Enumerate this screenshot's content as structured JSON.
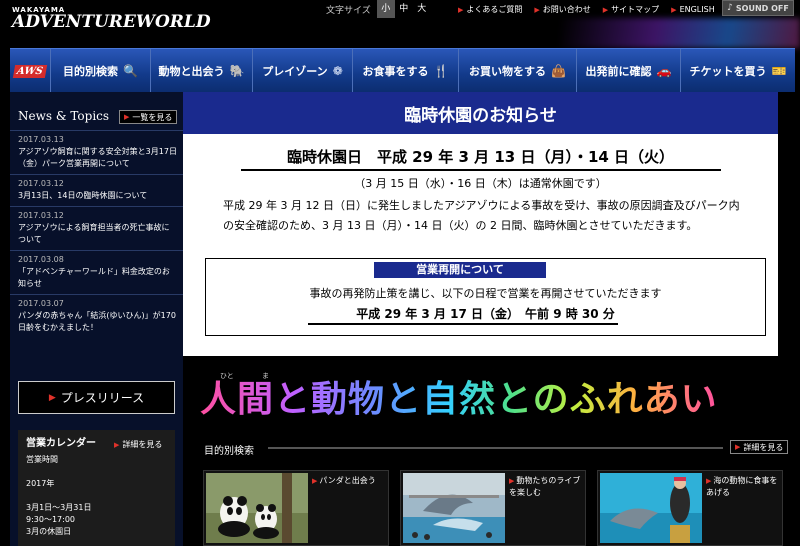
{
  "header": {
    "logo_small": "WAKAYAMA",
    "logo_main": "ADVENTUREWORLD",
    "font_size_label": "文字サイズ",
    "font_sizes": [
      "小",
      "中",
      "大"
    ],
    "font_size_selected": "小",
    "links": [
      "よくあるご質問",
      "お問い合わせ",
      "サイトマップ",
      "ENGLISH"
    ],
    "sound_label": "SOUND OFF"
  },
  "nav": {
    "logo": "AWS",
    "items": [
      {
        "label": "目的別検索",
        "icon": "search-icon",
        "glyph": "🔍"
      },
      {
        "label": "動物と出会う",
        "icon": "elephant-icon",
        "glyph": "🐘"
      },
      {
        "label": "プレイゾーン",
        "icon": "ferris-wheel-icon",
        "glyph": "❁"
      },
      {
        "label": "お食事をする",
        "icon": "cutlery-icon",
        "glyph": "🍴"
      },
      {
        "label": "お買い物をする",
        "icon": "shopping-bag-icon",
        "glyph": "👜"
      },
      {
        "label": "出発前に確認",
        "icon": "car-icon",
        "glyph": "🚗"
      },
      {
        "label": "チケットを買う",
        "icon": "ticket-icon",
        "glyph": "🎫"
      }
    ]
  },
  "sidebar": {
    "news_title": "News & Topics",
    "news_more": "一覧を見る",
    "news": [
      {
        "date": "2017.03.13",
        "title": "アジアゾウ飼育に関する安全対策と3月17日（金）パーク営業再開について"
      },
      {
        "date": "2017.03.12",
        "title": "3月13日、14日の臨時休園について"
      },
      {
        "date": "2017.03.12",
        "title": "アジアゾウによる飼育担当者の死亡事故について"
      },
      {
        "date": "2017.03.08",
        "title": "「アドベンチャーワールド」料金改定のお知らせ"
      },
      {
        "date": "2017.03.07",
        "title": "パンダの赤ちゃん「結浜(ゆいひん)」が170日齢をむかえました！"
      }
    ],
    "press_release": "プレスリリース",
    "calendar": {
      "title": "営業カレンダー",
      "more": "詳細を見る",
      "lines": [
        "営業時間",
        "",
        "2017年",
        "",
        "3月1日〜3月31日",
        "9:30〜17:00",
        "3月の休園日"
      ]
    }
  },
  "notice": {
    "heading": "臨時休園のお知らせ",
    "closure_date": "臨時休園日　平成 29 年 3 月 13 日（月）・14 日（火）",
    "regular_closure": "（3 月 15 日（水）・16 日（木）は通常休園です）",
    "body": "平成 29 年 3 月 12 日（日）に発生しましたアジアゾウによる事故を受け、事故の原因調査及びパーク内の安全確認のため、3 月 13 日（月）・14 日（火）の 2 日間、臨時休園とさせていただきます。",
    "reopen_label": "営業再開について",
    "reopen_text": "事故の再発防止策を講じ、以下の日程で営業を再開させていただきます",
    "reopen_date": "平成 29 年 3 月 17 日（金）　午前 9 時 30 分"
  },
  "slogan": {
    "text": "人間と動物と自然とのふれあい",
    "ruby_hito": "ひと",
    "ruby_ma": "ま"
  },
  "purpose": {
    "label": "目的別検索",
    "more": "詳細を見る",
    "cards": [
      {
        "label": "パンダと出会う"
      },
      {
        "label": "動物たちのライブを楽しむ"
      },
      {
        "label": "海の動物に食事をあげる"
      }
    ]
  },
  "colors": {
    "nav_blue": "#1a3f94",
    "notice_blue": "#1a2a8e",
    "accent_red": "#e0322a"
  }
}
